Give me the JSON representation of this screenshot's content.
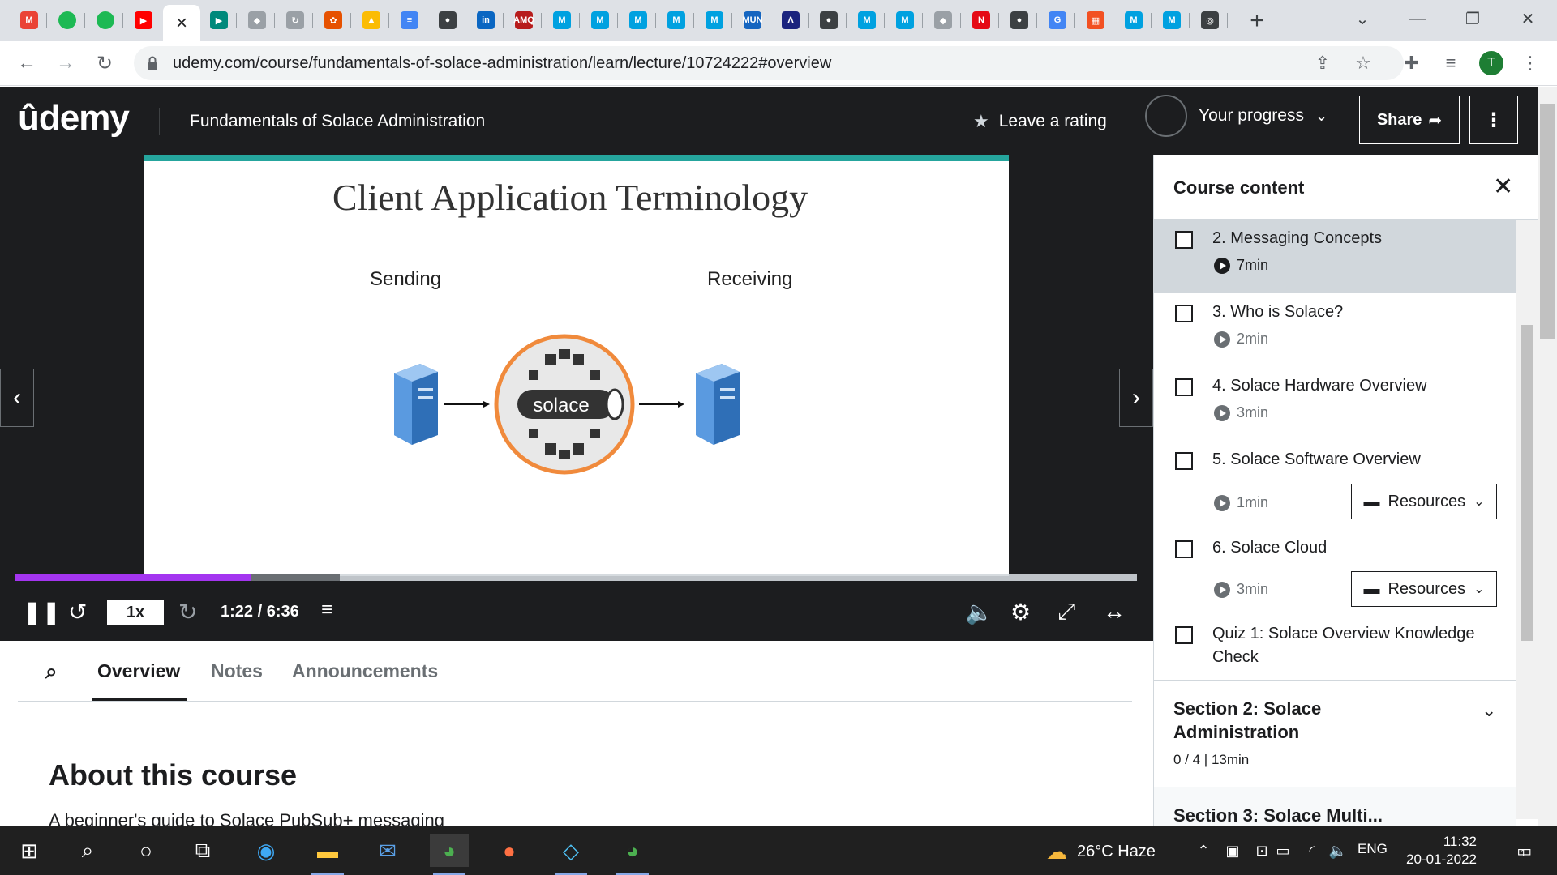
{
  "browser": {
    "active_tab_close": "×",
    "url": "udemy.com/course/fundamentals-of-solace-administration/learn/lecture/10724222#overview",
    "profile_initial": "T",
    "tab_favicons": [
      {
        "name": "gmail",
        "label": "M",
        "color": "#ea4335"
      },
      {
        "name": "green-app",
        "label": "",
        "color": "#1db954"
      },
      {
        "name": "green-app",
        "label": "",
        "color": "#1db954"
      },
      {
        "name": "youtube",
        "label": "▶",
        "color": "#ff0000"
      },
      {
        "name": "google-meet",
        "label": "▶",
        "color": "#00897b"
      },
      {
        "name": "web-app",
        "label": "◆",
        "color": "#9aa0a6"
      },
      {
        "name": "web-app",
        "label": "↻",
        "color": "#9aa0a6"
      },
      {
        "name": "web-app",
        "label": "✿",
        "color": "#e65100"
      },
      {
        "name": "google-drive",
        "label": "▲",
        "color": "#fbbc04"
      },
      {
        "name": "google-docs",
        "label": "≡",
        "color": "#4285f4"
      },
      {
        "name": "globe",
        "label": "●",
        "color": "#3c4043"
      },
      {
        "name": "linkedin",
        "label": "in",
        "color": "#0a66c2"
      },
      {
        "name": "amq",
        "label": "AMQ",
        "color": "#b71c1c"
      },
      {
        "name": "mulesoft",
        "label": "M",
        "color": "#00a1e0"
      },
      {
        "name": "mulesoft",
        "label": "M",
        "color": "#00a1e0"
      },
      {
        "name": "mulesoft",
        "label": "M",
        "color": "#00a1e0"
      },
      {
        "name": "mulesoft",
        "label": "M",
        "color": "#00a1e0"
      },
      {
        "name": "mulesoft",
        "label": "M",
        "color": "#00a1e0"
      },
      {
        "name": "mun",
        "label": "MUN",
        "color": "#1565c0"
      },
      {
        "name": "mountain-logo",
        "label": "Λ",
        "color": "#1a237e"
      },
      {
        "name": "globe",
        "label": "●",
        "color": "#3c4043"
      },
      {
        "name": "mulesoft",
        "label": "M",
        "color": "#00a1e0"
      },
      {
        "name": "mulesoft",
        "label": "M",
        "color": "#00a1e0"
      },
      {
        "name": "web-app",
        "label": "◆",
        "color": "#9aa0a6"
      },
      {
        "name": "netflix",
        "label": "N",
        "color": "#e50914"
      },
      {
        "name": "globe",
        "label": "●",
        "color": "#3c4043"
      },
      {
        "name": "google",
        "label": "G",
        "color": "#4285f4"
      },
      {
        "name": "microsoft",
        "label": "▦",
        "color": "#f25022"
      },
      {
        "name": "mulesoft",
        "label": "M",
        "color": "#00a1e0"
      },
      {
        "name": "mulesoft",
        "label": "M",
        "color": "#00a1e0"
      },
      {
        "name": "chrome-alt",
        "label": "◎",
        "color": "#3c4043"
      }
    ]
  },
  "udemy": {
    "logo": "ûdemy",
    "course_title": "Fundamentals of Solace Administration",
    "rating_label": "Leave a rating",
    "progress_label": "Your progress",
    "share_label": "Share",
    "accent": "#a435f0"
  },
  "video": {
    "slide_title": "Client Application Terminology",
    "sending": "Sending",
    "receiving": "Receiving",
    "broker_text": "solace",
    "speed": "1x",
    "time": "1:22 / 6:36",
    "played_fraction": 0.21,
    "buffered_fraction": 0.29
  },
  "tabs": [
    "Overview",
    "Notes",
    "Announcements"
  ],
  "about": {
    "heading": "About this course",
    "text": "A beginner's guide to Solace PubSub+ messaging"
  },
  "sidebar": {
    "title": "Course content",
    "items": [
      {
        "title": "2. Messaging Concepts",
        "duration": "7min"
      },
      {
        "title": "3. Who is Solace?",
        "duration": "2min"
      },
      {
        "title": "4. Solace Hardware Overview",
        "duration": "3min"
      },
      {
        "title": "5. Solace Software Overview",
        "duration": "1min",
        "resources": "Resources"
      },
      {
        "title": "6. Solace Cloud",
        "duration": "3min",
        "resources": "Resources"
      },
      {
        "title": "Quiz 1: Solace Overview Knowledge Check"
      }
    ],
    "section2": {
      "title": "Section 2: Solace Administration",
      "meta": "0 / 4 | 13min"
    },
    "section3": {
      "title": "Section 3: Solace Multi..."
    }
  },
  "taskbar": {
    "weather": "26°C  Haze",
    "lang": "ENG",
    "time": "11:32",
    "date": "20-01-2022",
    "notifications": "1"
  }
}
